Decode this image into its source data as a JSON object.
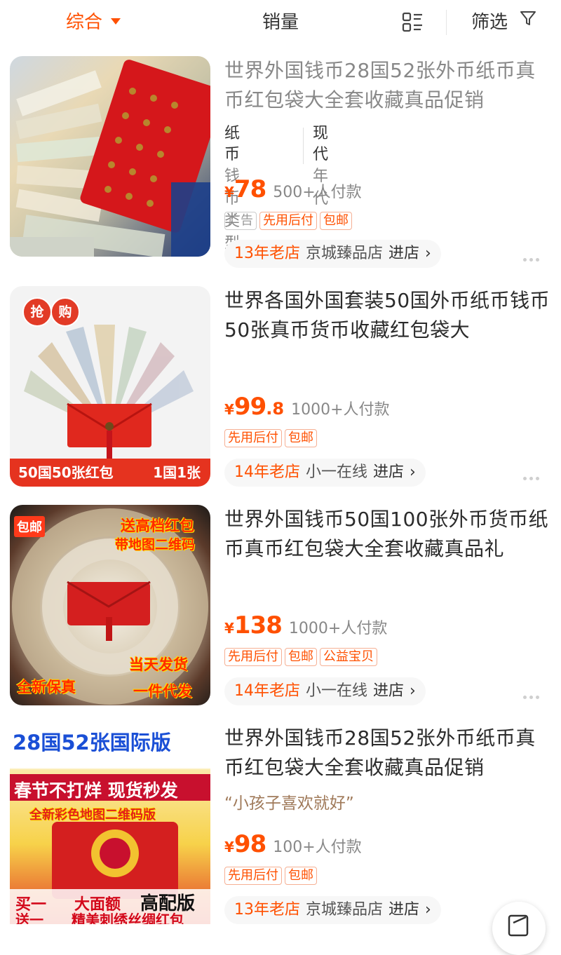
{
  "sort_bar": {
    "composite_label": "综合",
    "sales_label": "销量",
    "filter_label": "筛选"
  },
  "products": [
    {
      "title": "世界外国钱币28国52张外币纸币真币红包袋大全套收藏真品促销",
      "attributes": [
        {
          "value": "纸币",
          "key": "钱币类型"
        },
        {
          "value": "现代",
          "key": "年代"
        }
      ],
      "price_symbol": "¥",
      "price_int": "78",
      "price_dec": "",
      "sales": "500+人付款",
      "tags": [
        "广告",
        "先用后付",
        "包邮"
      ],
      "shop_age": "13年老店",
      "shop_name": "京城臻品店",
      "enter_label": "进店",
      "is_ad": true
    },
    {
      "title": "世界各国外国套装50国外币纸币钱币50张真币货币收藏红包袋大",
      "thumb_badges": [
        "抢",
        "购"
      ],
      "thumb_banner_left": "50国50张红包",
      "thumb_banner_right": "1国1张",
      "price_symbol": "¥",
      "price_int": "99",
      "price_dec": ".8",
      "sales": "1000+人付款",
      "tags": [
        "先用后付",
        "包邮"
      ],
      "shop_age": "14年老店",
      "shop_name": "小一在线",
      "enter_label": "进店"
    },
    {
      "title": "世界外国钱币50国100张外币货币纸币真币红包袋大全套收藏真品礼",
      "thumb_overlays": [
        "包邮",
        "送高档红包",
        "带地图二维码",
        "当天发货",
        "全新保真",
        "一件代发"
      ],
      "price_symbol": "¥",
      "price_int": "138",
      "price_dec": "",
      "sales": "1000+人付款",
      "tags": [
        "先用后付",
        "包邮",
        "公益宝贝"
      ],
      "shop_age": "14年老店",
      "shop_name": "小一在线",
      "enter_label": "进店"
    },
    {
      "title": "世界外国钱币28国52张外币纸币真币红包袋大全套收藏真品促销",
      "quote": "“小孩子喜欢就好”",
      "thumb_overlays": [
        "28国52张国际版",
        "春节不打烊 现货秒发",
        "全新彩色地图二维码版",
        "买一",
        "大面额",
        "高配版",
        "送一",
        "精美刺绣丝绸红包"
      ],
      "price_symbol": "¥",
      "price_int": "98",
      "price_dec": "",
      "sales": "100+人付款",
      "tags": [
        "先用后付",
        "包邮"
      ],
      "shop_age": "13年老店",
      "shop_name": "京城臻品店",
      "enter_label": "进店"
    }
  ],
  "colors": {
    "accent": "#ff5000",
    "tag_border": "#f6b094",
    "muted": "#888888"
  }
}
